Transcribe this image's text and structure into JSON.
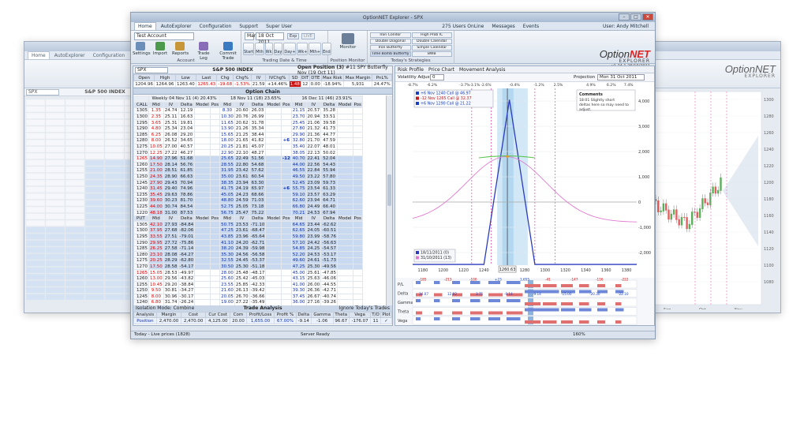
{
  "app": {
    "title": "OptionNET Explorer - SPX",
    "logo_option": "Option",
    "logo_net": "NET",
    "logo_sub": "EXPLORER",
    "version": "v1.24.1 26/10/2011",
    "online": "275 Users OnLine",
    "user": "User: Andy Mitchell",
    "status_left": "Today - Live prices (1828)",
    "status_mid": "Server Ready",
    "zoom": "160%"
  },
  "menu": {
    "tabs": [
      "Home",
      "AutoExplorer",
      "Configuration",
      "Support",
      "Super User"
    ],
    "active": "Home"
  },
  "ribbon": {
    "account_combo": "Test Account",
    "buttons": [
      "Settings",
      "Import",
      "Reports",
      "Trade Log",
      "Commit Trade"
    ],
    "group_account": "Account",
    "date_combo": "Mar",
    "date_value": "18 Oct 2011",
    "exp_label": "Exp",
    "live_label": "LIVE",
    "nav_buttons": [
      "Start",
      "Mth",
      "Wk",
      "Day",
      "Day+",
      "Wk+",
      "Mth+",
      "End"
    ],
    "group_datetime": "Trading Date & Time",
    "position_monitor_btn": "Position Monitor",
    "monitor_btn": "Monitor",
    "strategies": [
      "Iron Condor",
      "High Prob IC",
      "Double Diagonal",
      "Double Calendar",
      "Iron Butterfly",
      "Simple Calendar",
      "Time Bomb Butterfly",
      "BWB"
    ],
    "group_strategies": "Today's Strategies",
    "messages": "Messages",
    "events": "Events"
  },
  "quote": {
    "symbol": "SPX",
    "title": "S&P 500 INDEX",
    "headers": [
      "Open",
      "High",
      "Low",
      "Last",
      "Chg",
      "Chg%",
      "IV",
      "IVChg%",
      "SD"
    ],
    "values": [
      "1204.96",
      "1264.96",
      "1263.40",
      "1265.43",
      "-19.68",
      "-1.53%",
      "21.59",
      "+14.46%",
      "1.48"
    ]
  },
  "position": {
    "title": "Open Position (3)",
    "subtitle": "#11 SPY Butterfly Nov (19 Oct 11)",
    "headers": [
      "DIT",
      "DTE",
      "Max Risk",
      "Max Margin",
      "PnL%"
    ],
    "values": [
      "12",
      "0.00",
      "-18.94%",
      "5,931",
      "24.47%"
    ]
  },
  "chain": {
    "title": "Option Chain",
    "expiries": [
      "Weekly  04 Nov 11 (4)  20.43%",
      "18 Nov 11 (18)  23.65%",
      "16 Dec 11 (46)  23.91%"
    ],
    "col_headers": [
      "Mid",
      "IV",
      "Delta",
      "Model",
      "Pos"
    ],
    "call_label": "CALL",
    "put_label": "PUT",
    "strikes": [
      "1305",
      "1300",
      "1295",
      "1290",
      "1285",
      "1280",
      "1275",
      "1270",
      "1265",
      "1260",
      "1255",
      "1250",
      "1245",
      "1240",
      "1235",
      "1230",
      "1225",
      "1220"
    ],
    "call_rows": [
      [
        "1.35",
        "24.74",
        "12.19",
        "8.30",
        "20.60",
        "26.03",
        "21.15",
        "20.57",
        "35.28"
      ],
      [
        "2.35",
        "25.11",
        "16.63",
        "10.30",
        "20.76",
        "26.99",
        "23.70",
        "20.94",
        "33.51"
      ],
      [
        "3.65",
        "25.31",
        "19.81",
        "11.65",
        "20.62",
        "31.78",
        "25.45",
        "21.06",
        "39.58"
      ],
      [
        "4.80",
        "25.34",
        "23.04",
        "13.90",
        "21.26",
        "35.34",
        "27.80",
        "21.32",
        "41.73"
      ],
      [
        "6.25",
        "26.08",
        "29.20",
        "15.65",
        "21.25",
        "38.44",
        "29.90",
        "21.36",
        "44.77"
      ],
      [
        "8.00",
        "26.52",
        "34.65",
        "18.00",
        "21.65",
        "41.82",
        "32.80",
        "21.70",
        "47.59"
      ],
      [
        "10.05",
        "27.00",
        "40.57",
        "20.25",
        "21.81",
        "45.07",
        "35.40",
        "22.07",
        "48.01"
      ],
      [
        "12.25",
        "27.22",
        "46.27",
        "22.90",
        "22.10",
        "48.27",
        "38.05",
        "22.13",
        "50.02"
      ],
      [
        "14.90",
        "27.96",
        "51.68",
        "25.65",
        "22.49",
        "51.56",
        "40.70",
        "22.41",
        "52.04"
      ],
      [
        "17.50",
        "28.14",
        "56.76",
        "28.55",
        "22.80",
        "54.68",
        "44.00",
        "22.56",
        "54.43"
      ],
      [
        "21.00",
        "28.51",
        "61.85",
        "31.95",
        "23.42",
        "57.62",
        "46.55",
        "22.84",
        "55.94"
      ],
      [
        "24.35",
        "28.90",
        "66.63",
        "35.00",
        "23.61",
        "60.54",
        "49.50",
        "23.22",
        "57.80"
      ],
      [
        "27.90",
        "29.43",
        "70.94",
        "38.35",
        "23.94",
        "63.30",
        "52.45",
        "23.09",
        "59.73"
      ],
      [
        "31.45",
        "29.40",
        "74.96",
        "41.75",
        "24.19",
        "65.97",
        "55.75",
        "23.54",
        "61.33"
      ],
      [
        "35.45",
        "29.63",
        "78.86",
        "45.05",
        "24.23",
        "68.66",
        "59.10",
        "23.57",
        "63.29"
      ],
      [
        "39.60",
        "30.23",
        "81.70",
        "48.80",
        "24.59",
        "71.03",
        "62.60",
        "23.94",
        "64.71"
      ],
      [
        "44.00",
        "30.74",
        "84.54",
        "52.75",
        "25.05",
        "73.18",
        "66.80",
        "24.49",
        "66.40"
      ],
      [
        "48.18",
        "31.00",
        "87.53",
        "56.75",
        "25.47",
        "75.22",
        "70.21",
        "24.53",
        "67.94"
      ]
    ],
    "put_rows": [
      [
        "42.10",
        "27.93",
        "-84.84",
        "50.75",
        "23.53",
        "-71.10",
        "64.65",
        "23.44",
        "-62.62"
      ],
      [
        "37.95",
        "27.68",
        "-82.06",
        "47.25",
        "23.61",
        "-68.47",
        "62.65",
        "24.05",
        "-60.51"
      ],
      [
        "33.55",
        "27.51",
        "-79.01",
        "43.85",
        "23.96",
        "-65.64",
        "59.80",
        "23.99",
        "-58.76"
      ],
      [
        "29.95",
        "27.72",
        "-75.86",
        "41.10",
        "24.20",
        "-62.71",
        "57.10",
        "24.42",
        "-56.63"
      ],
      [
        "26.25",
        "27.58",
        "-71.14",
        "38.20",
        "24.39",
        "-59.98",
        "54.85",
        "24.25",
        "-54.57"
      ],
      [
        "23.10",
        "28.08",
        "-64.27",
        "35.30",
        "24.56",
        "-56.58",
        "52.20",
        "24.53",
        "-53.17"
      ],
      [
        "20.25",
        "28.29",
        "-62.80",
        "32.55",
        "24.45",
        "-53.37",
        "49.60",
        "24.61",
        "-51.73"
      ],
      [
        "17.50",
        "28.58",
        "-54.17",
        "30.50",
        "25.30",
        "-51.18",
        "47.25",
        "25.30",
        "-49.56"
      ],
      [
        "15.05",
        "28.53",
        "-49.97",
        "28.00",
        "25.48",
        "-48.17",
        "45.00",
        "25.61",
        "-47.85"
      ],
      [
        "13.00",
        "29.56",
        "-43.82",
        "25.60",
        "25.42",
        "-45.03",
        "43.15",
        "25.63",
        "-46.06"
      ],
      [
        "10.45",
        "29.20",
        "-38.84",
        "23.55",
        "25.85",
        "-42.33",
        "41.00",
        "26.00",
        "-44.55"
      ],
      [
        "9.50",
        "30.81",
        "-34.27",
        "21.60",
        "26.13",
        "-39.42",
        "39.30",
        "26.36",
        "-42.71"
      ],
      [
        "8.00",
        "30.96",
        "-30.17",
        "20.05",
        "26.70",
        "-36.66",
        "37.45",
        "26.67",
        "-40.74"
      ],
      [
        "6.80",
        "31.74",
        "-26.24",
        "19.00",
        "27.22",
        "-35.49",
        "36.00",
        "27.16",
        "-39.26"
      ],
      [
        "5.75",
        "32.29",
        "-22.60",
        "17.25",
        "27.40",
        "-32.89",
        "34.50",
        "27.63",
        "-37.78"
      ],
      [
        "4.85",
        "32.94",
        "-19.73",
        "16.25",
        "28.00",
        "-31.07",
        "32.40",
        "27.37",
        "-36.44"
      ],
      [
        "4.05",
        "33.30",
        "-16.93",
        "14.95",
        "28.39",
        "-29.17",
        "31.20",
        "27.65",
        "-34.08"
      ],
      [
        "3.45",
        "33.96",
        "-14.52",
        "13.78",
        "28.60",
        "-27.38",
        "29.90",
        "27.60",
        "-32.70"
      ]
    ]
  },
  "trade_analysis": {
    "title": "Trade Analysis",
    "isolation_label": "Isolation Mode: Combine",
    "ignore_label": "Ignore Today's Trades",
    "headers": [
      "Analysis",
      "Margin",
      "Cost",
      "Cur Cost",
      "Com",
      "Profit/Loss",
      "Profit %",
      "Delta",
      "Gamma",
      "Theta",
      "Vega",
      "T/O",
      "Plot"
    ],
    "row": [
      "Position",
      "2,470.00",
      "2,470.00",
      "4,125.00",
      "20.00",
      "1,655.00",
      "67.00%",
      "-9.14",
      "-1.06",
      "96.67",
      "-176.07",
      "11",
      "✓"
    ]
  },
  "risk": {
    "tabs": [
      "Risk Profile",
      "Price Chart",
      "Movement Analysis"
    ],
    "volatility_label": "Volatility Adjust",
    "volatility_value": "0",
    "projection_label": "Projection",
    "projection_value": "Mon 31 Oct 2011",
    "pct_ticks": [
      "-8.7%",
      "-6.2%",
      "-3.7%",
      "-3.1%",
      "-2.6%",
      "-0.4%",
      "-1.2%",
      "2.5%",
      "4.9%",
      "6.2%",
      "7.4%"
    ],
    "x_ticks": [
      "1180",
      "1200",
      "1220",
      "1240",
      "1260",
      "1280",
      "1300",
      "1320",
      "1340",
      "1360",
      "1380"
    ],
    "y_ticks": [
      "4,000",
      "3,000",
      "2,000",
      "1,000",
      "0",
      "-1,000",
      "-2,000"
    ],
    "price_marker": "1260.63",
    "legend": [
      "+6 Nov 1240 Call @ 46.97",
      "-12 Nov 1265 Call @ 32.37",
      "+6 Nov 1290 Call @ 21.22"
    ],
    "legend2": [
      "18/11/2011 (0)",
      "31/10/2011 (13)"
    ],
    "comments_title": "Comments",
    "comment": "18:01 Slightly short deltas here so may need to adjust.",
    "greeks": [
      "P/L",
      "Delta",
      "Gamma",
      "Theta",
      "Vega"
    ],
    "pl_values": [
      "-185",
      "-213",
      "-100",
      "+23",
      "1,655",
      "-41",
      "-147",
      "-116",
      "-222"
    ],
    "delta_values": [
      "34.07",
      "12.92",
      "3.71",
      "-0.14",
      "-9.14",
      "-15.00",
      "-20.30",
      "-22.10"
    ]
  },
  "back_right": {
    "logo": "OptionNET",
    "sub": "EXPLORER",
    "dates": [
      "Sep",
      "Oct",
      "Nov"
    ],
    "y_ticks": [
      "1300",
      "1280",
      "1260",
      "1240",
      "1220",
      "1200",
      "1180",
      "1160",
      "1140",
      "1120",
      "1100",
      "1080"
    ]
  },
  "back_left": {
    "symbol": "SPX",
    "title": "S&P 500 INDEX"
  },
  "colors": {
    "accent": "#2a4c8c",
    "call_bg": "#c9daf0",
    "profit_line": "#2b3bbd",
    "loss_red": "#d00000"
  }
}
